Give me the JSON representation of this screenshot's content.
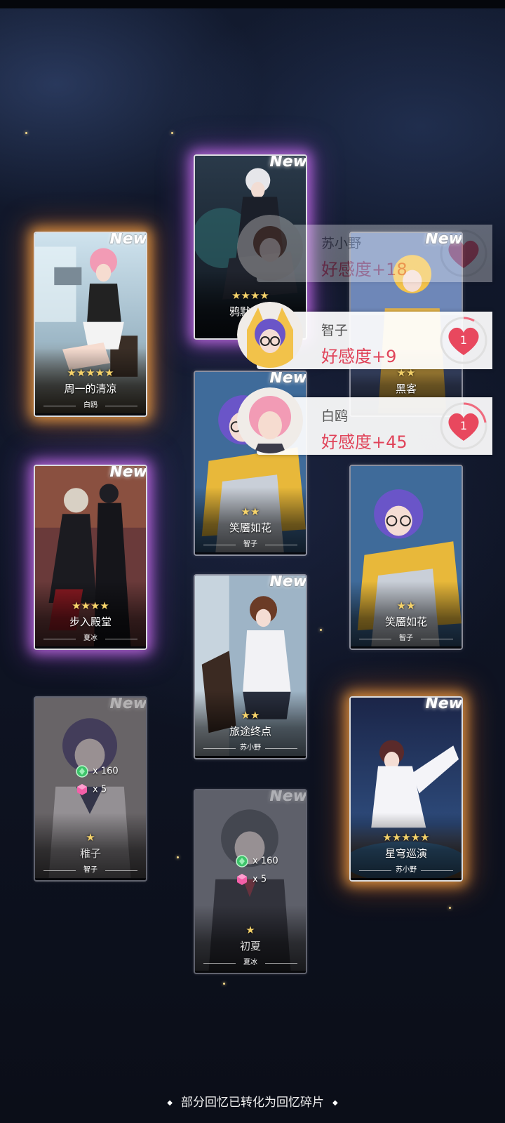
{
  "cards": [
    {
      "id": "c1",
      "stars": "★★★★★",
      "title": "周一的清凉",
      "owner": "白鸥",
      "new": "New",
      "glow": "gold"
    },
    {
      "id": "c2",
      "stars": "★★★★",
      "title": "鸦默雀静",
      "owner": "",
      "new": "New",
      "glow": "purple"
    },
    {
      "id": "c3",
      "stars": "★★",
      "title": "黑客",
      "owner": "",
      "new": "New",
      "glow": "none"
    },
    {
      "id": "c4",
      "stars": "★★",
      "title": "笑靥如花",
      "owner": "智子",
      "new": "New",
      "glow": "none"
    },
    {
      "id": "c5",
      "stars": "★★★★",
      "title": "步入殿堂",
      "owner": "夏冰",
      "new": "New",
      "glow": "purple"
    },
    {
      "id": "c6",
      "stars": "★★",
      "title": "笑靥如花",
      "owner": "智子",
      "new": "",
      "glow": "none"
    },
    {
      "id": "c7",
      "stars": "★★",
      "title": "旅途终点",
      "owner": "苏小野",
      "new": "New",
      "glow": "none"
    },
    {
      "id": "c8",
      "stars": "★",
      "title": "稚子",
      "owner": "智子",
      "new": "New",
      "glow": "dim",
      "fragments": {
        "green": "x 160",
        "pink": "x 5"
      }
    },
    {
      "id": "c9",
      "stars": "★★★★★",
      "title": "星穹巡演",
      "owner": "苏小野",
      "new": "New",
      "glow": "gold"
    },
    {
      "id": "c10",
      "stars": "★",
      "title": "初夏",
      "owner": "夏冰",
      "new": "New",
      "glow": "dim",
      "fragments": {
        "green": "x 160",
        "pink": "x 5"
      }
    }
  ],
  "toasts": [
    {
      "name": "苏小野",
      "affection": "好感度+18",
      "level": "1"
    },
    {
      "name": "智子",
      "affection": "好感度+9",
      "level": "1"
    },
    {
      "name": "白鸥",
      "affection": "好感度+45",
      "level": "1"
    }
  ],
  "footer": {
    "text": "部分回忆已转化为回忆碎片"
  },
  "colors": {
    "gold_glow": "#ffaa46",
    "purple_glow": "#dc78ff",
    "affection": "#e0445a",
    "heart": "#e8485e"
  }
}
